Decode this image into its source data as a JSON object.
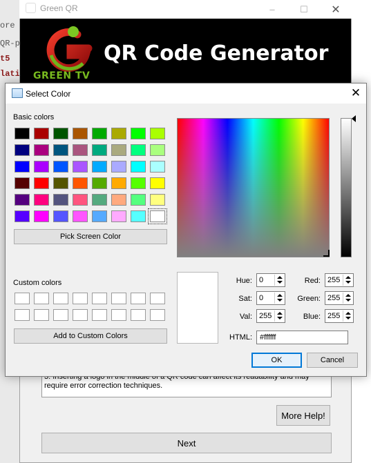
{
  "background_app": {
    "title": "Green QR",
    "logo_text": "GREEN TV",
    "heading": "QR Code Generator",
    "left_fragments": [
      "ore",
      "QR-p",
      "t5",
      "lati"
    ],
    "note_text": "3. Inserting a logo in the middle of a QR code can affect its readability and may require error correction techniques.",
    "more_help_label": "More Help!",
    "next_label": "Next"
  },
  "dialog": {
    "title": "Select Color",
    "basic_colors_label": "Basic colors",
    "basic_colors": [
      [
        "#000000",
        "#aa0000",
        "#005500",
        "#aa5500",
        "#00aa00",
        "#aaaa00",
        "#00ff00",
        "#aaff00"
      ],
      [
        "#00007f",
        "#aa007f",
        "#00557f",
        "#aa557f",
        "#00aa7f",
        "#aaaa7f",
        "#00ff7f",
        "#aaff7f"
      ],
      [
        "#0000ff",
        "#aa00ff",
        "#0055ff",
        "#aa55ff",
        "#00aaff",
        "#aaaaff",
        "#00ffff",
        "#aaffff"
      ],
      [
        "#550000",
        "#ff0000",
        "#555500",
        "#ff5500",
        "#55aa00",
        "#ffaa00",
        "#55ff00",
        "#ffff00"
      ],
      [
        "#55007f",
        "#ff007f",
        "#55557f",
        "#ff557f",
        "#55aa7f",
        "#ffaa7f",
        "#55ff7f",
        "#ffff7f"
      ],
      [
        "#5500ff",
        "#ff00ff",
        "#5555ff",
        "#ff55ff",
        "#55aaff",
        "#ffaaff",
        "#55ffff",
        "#ffffff"
      ]
    ],
    "pick_screen_label": "Pick Screen Color",
    "custom_colors_label": "Custom colors",
    "add_custom_label": "Add to Custom Colors",
    "fields": {
      "hue_label": "Hue:",
      "hue": "0",
      "sat_label": "Sat:",
      "sat": "0",
      "val_label": "Val:",
      "val": "255",
      "red_label": "Red:",
      "red": "255",
      "green_label": "Green:",
      "green": "255",
      "blue_label": "Blue:",
      "blue": "255",
      "html_label": "HTML:",
      "html": "#ffffff"
    },
    "ok_label": "OK",
    "cancel_label": "Cancel",
    "current_color": "#ffffff"
  }
}
